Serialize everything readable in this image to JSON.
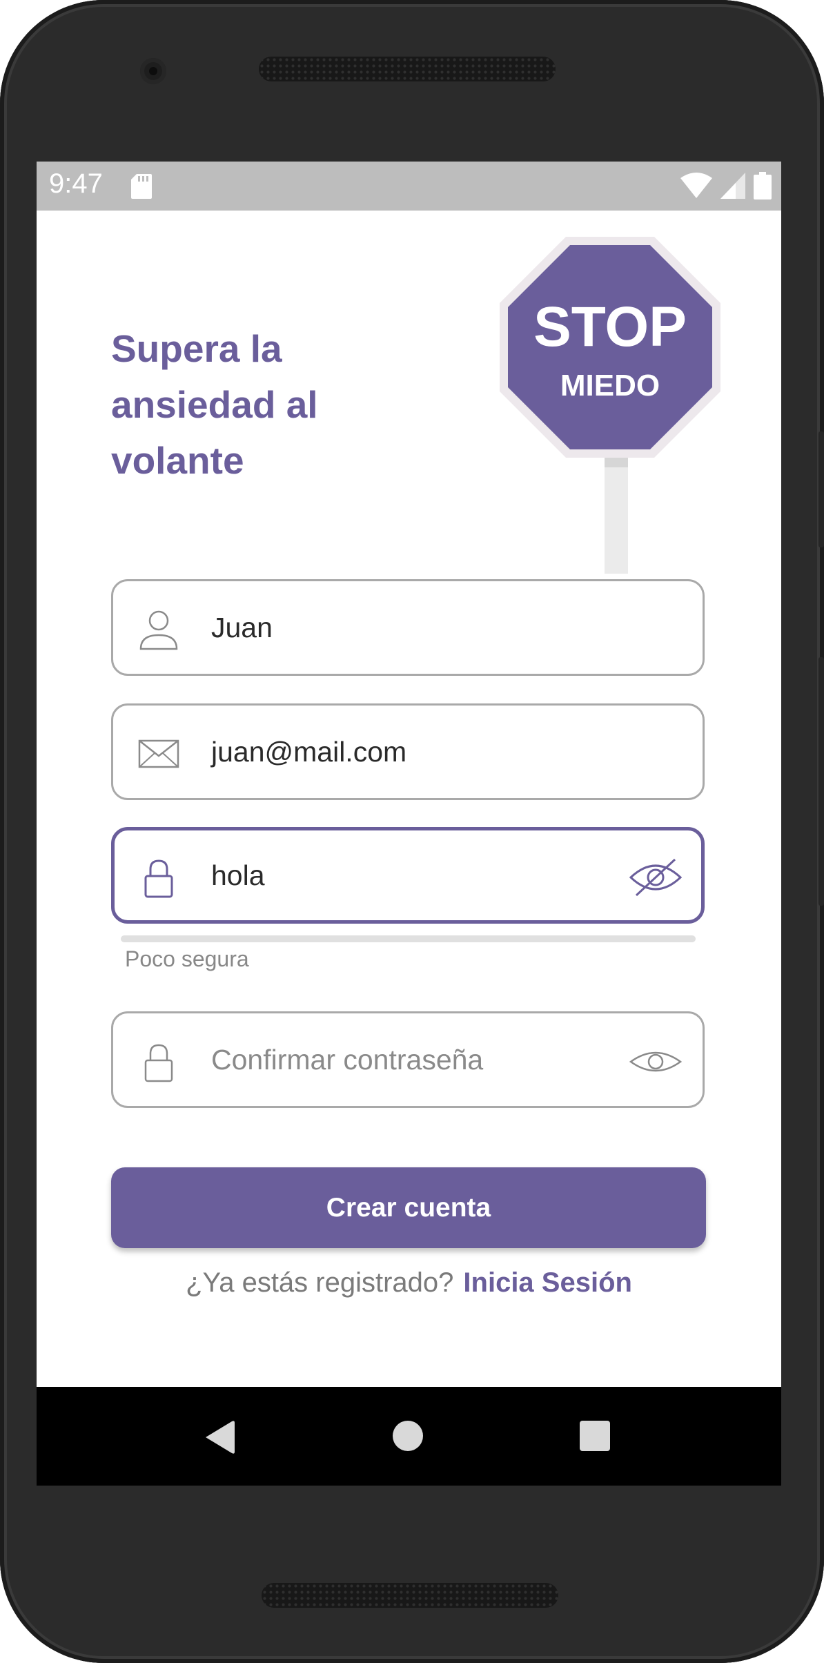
{
  "statusbar": {
    "time": "9:47",
    "icons": [
      "sd-card-icon",
      "wifi-icon",
      "signal-icon",
      "battery-icon"
    ]
  },
  "headline": {
    "line1": "Supera la",
    "line2": "ansiedad al",
    "line3": "volante"
  },
  "sign": {
    "title": "STOP",
    "subtitle": "MIEDO"
  },
  "form": {
    "name_value": "Juan",
    "email_value": "juan@mail.com",
    "password_value": "hola",
    "password_strength_label": "Poco segura",
    "confirm_placeholder": "Confirmar contraseña",
    "submit_label": "Crear cuenta"
  },
  "login_prompt": {
    "question": "¿Ya estás registrado?",
    "link": "Inicia Sesión"
  },
  "navbar": {
    "icons": [
      "back-icon",
      "home-icon",
      "recents-icon"
    ]
  },
  "colors": {
    "accent": "#6a5e9b",
    "statusbar": "#bdbdbd",
    "border": "#a9a9a9"
  }
}
